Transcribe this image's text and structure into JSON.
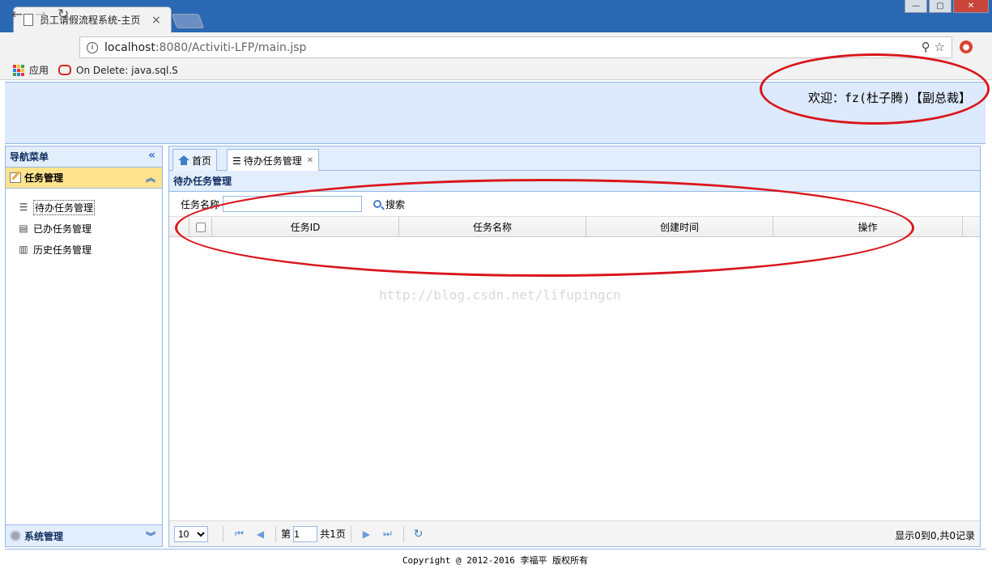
{
  "browser": {
    "tab_title": "员工请假流程系统-主页",
    "url_host": "localhost",
    "url_path": ":8080/Activiti-LFP/main.jsp",
    "bookmarks": [
      "应用",
      "On Delete: java.sql.S"
    ]
  },
  "header": {
    "welcome": "欢迎：fz(杜子腾)【副总裁】"
  },
  "left_panel": {
    "title": "导航菜单",
    "group_task": "任务管理",
    "items": [
      {
        "label": "待办任务管理",
        "icon": "checklist-icon"
      },
      {
        "label": "已办任务管理",
        "icon": "document-icon"
      },
      {
        "label": "历史任务管理",
        "icon": "history-icon"
      }
    ],
    "group_system": "系统管理"
  },
  "main": {
    "tabs": [
      {
        "label": "首页"
      },
      {
        "label": "待办任务管理"
      }
    ],
    "grid_title": "待办任务管理",
    "search_label": "任务名称",
    "search_value": "",
    "search_button": "搜索",
    "columns": [
      "任务ID",
      "任务名称",
      "创建时间",
      "操作"
    ],
    "rows": [],
    "pager": {
      "page_size": "10",
      "page_prefix": "第",
      "page_value": "1",
      "page_total": "共1页",
      "info": "显示0到0,共0记录"
    }
  },
  "footer": {
    "copyright": "Copyright @ 2012-2016 李福平 版权所有"
  },
  "watermark": "http://blog.csdn.net/lifupingcn",
  "colors": {
    "border": "#95b8e7",
    "header_bg": "#dde9fc",
    "selected_group": "#ffe48d",
    "annotation": "#d9161c"
  }
}
